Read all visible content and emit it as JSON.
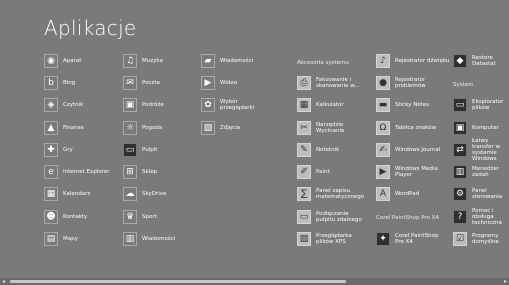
{
  "title": "Aplikacje",
  "groups": {
    "accessories": "Akcesoria systemu",
    "corel": "Corel PaintShop Pro X4",
    "system": "System"
  },
  "col1": [
    {
      "label": "Aparat",
      "icon": "camera-icon"
    },
    {
      "label": "Bing",
      "icon": "bing-icon"
    },
    {
      "label": "Czytnik",
      "icon": "reader-icon"
    },
    {
      "label": "Finanse",
      "icon": "finance-icon"
    },
    {
      "label": "Gry",
      "icon": "games-icon"
    },
    {
      "label": "Internet Explorer",
      "icon": "ie-icon"
    },
    {
      "label": "Kalendarz",
      "icon": "calendar-icon"
    },
    {
      "label": "Kontakty",
      "icon": "people-icon"
    },
    {
      "label": "Mapy",
      "icon": "maps-icon"
    }
  ],
  "col2": [
    {
      "label": "Muzyka",
      "icon": "music-icon"
    },
    {
      "label": "Poczta",
      "icon": "mail-icon"
    },
    {
      "label": "Podróże",
      "icon": "travel-icon"
    },
    {
      "label": "Pogoda",
      "icon": "weather-icon"
    },
    {
      "label": "Pulpit",
      "icon": "desktop-icon"
    },
    {
      "label": "Sklep",
      "icon": "store-icon"
    },
    {
      "label": "SkyDrive",
      "icon": "skydrive-icon"
    },
    {
      "label": "Sport",
      "icon": "sport-icon"
    },
    {
      "label": "Wiadomości",
      "icon": "news-icon"
    }
  ],
  "col3": [
    {
      "label": "Wiadomości",
      "icon": "messaging-icon"
    },
    {
      "label": "Wideo",
      "icon": "video-icon"
    },
    {
      "label": "Wybór\nprzeglądarki",
      "icon": "browser-choice-icon"
    },
    {
      "label": "Zdjęcia",
      "icon": "photos-icon"
    }
  ],
  "col4": [
    {
      "label": "Faksowanie i\nskanowanie w...",
      "icon": "fax-icon"
    },
    {
      "label": "Kalkulator",
      "icon": "calculator-icon"
    },
    {
      "label": "Narzędzie\nWycinanie",
      "icon": "snipping-tool-icon"
    },
    {
      "label": "Notatnik",
      "icon": "notepad-icon"
    },
    {
      "label": "Paint",
      "icon": "paint-icon"
    },
    {
      "label": "Panel zapisu\nmatematycznego",
      "icon": "math-panel-icon"
    },
    {
      "label": "Podłączanie\npulpitu zdalnego",
      "icon": "remote-desktop-icon"
    },
    {
      "label": "Przeglądarka\nplików XPS",
      "icon": "xps-viewer-icon"
    }
  ],
  "col5a": [
    {
      "label": "Rejestrator dźwięku",
      "icon": "sound-recorder-icon"
    },
    {
      "label": "Rejestrator\nproblemów",
      "icon": "steps-recorder-icon"
    },
    {
      "label": "Sticky Notes",
      "icon": "sticky-notes-icon"
    },
    {
      "label": "Tablica znaków",
      "icon": "charmap-icon"
    },
    {
      "label": "Windows Journal",
      "icon": "journal-icon"
    },
    {
      "label": "Windows Media\nPlayer",
      "icon": "media-player-icon"
    },
    {
      "label": "WordPad",
      "icon": "wordpad-icon"
    }
  ],
  "col5b": [
    {
      "label": "Corel PaintShop\nPro X4",
      "icon": "paintshop-icon"
    },
    {
      "label": "Programy\ndomyślne",
      "icon": "default-programs-icon"
    }
  ],
  "col6a": [
    {
      "label": "Restore Datastat",
      "icon": "restore-icon"
    }
  ],
  "col6b": [
    {
      "label": "Eksplorator plików",
      "icon": "explorer-icon"
    },
    {
      "label": "Komputer",
      "icon": "computer-icon"
    },
    {
      "label": "Łatwy transfer w\nsystemie Windows",
      "icon": "transfer-icon"
    },
    {
      "label": "Menedżer zadań",
      "icon": "task-manager-icon"
    },
    {
      "label": "Panel sterowania",
      "icon": "control-panel-icon"
    },
    {
      "label": "Pomoc i obsługa\ntechniczna",
      "icon": "help-icon"
    },
    {
      "label": "Uruchom",
      "icon": "run-icon"
    }
  ]
}
